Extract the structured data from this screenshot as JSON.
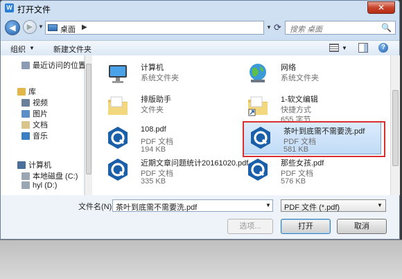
{
  "window": {
    "title": "打开文件",
    "close_glyph": "✕"
  },
  "nav": {
    "address_location": "桌面",
    "search_placeholder": "搜索 桌面"
  },
  "toolbar": {
    "organize_label": "组织",
    "new_folder_label": "新建文件夹"
  },
  "sidebar": {
    "items": [
      {
        "label": "最近访问的位置",
        "icon": "recent-places-icon",
        "color": "#8a9bb3"
      },
      {
        "label": "库",
        "icon": "library-icon",
        "color": "#e3b64a"
      },
      {
        "label": "视频",
        "icon": "video-icon",
        "color": "#6a7f9a"
      },
      {
        "label": "图片",
        "icon": "pictures-icon",
        "color": "#5b8fc7"
      },
      {
        "label": "文档",
        "icon": "documents-icon",
        "color": "#d9c589"
      },
      {
        "label": "音乐",
        "icon": "music-icon",
        "color": "#3a7fc4"
      },
      {
        "label": "计算机",
        "icon": "computer-icon",
        "color": "#4a6f9a"
      },
      {
        "label": "本地磁盘 (C:)",
        "icon": "disk-icon",
        "color": "#9aa6b2"
      },
      {
        "label": "hyl (D:)",
        "icon": "disk-icon",
        "color": "#9aa6b2"
      }
    ]
  },
  "files": [
    {
      "name": "计算机",
      "meta1": "系统文件夹",
      "meta2": "",
      "icon": "computer-icon",
      "selected": false
    },
    {
      "name": "网络",
      "meta1": "系统文件夹",
      "meta2": "",
      "icon": "network-icon",
      "selected": false
    },
    {
      "name": "排版助手",
      "meta1": "文件夹",
      "meta2": "",
      "icon": "folder-icon",
      "selected": false
    },
    {
      "name": "1-软文编辑",
      "meta1": "快捷方式",
      "meta2": "655 字节",
      "icon": "shortcut-folder-icon",
      "selected": false
    },
    {
      "name": "108.pdf",
      "meta1": "PDF 文档",
      "meta2": "194 KB",
      "icon": "pdf-icon",
      "selected": false
    },
    {
      "name": "茶叶到底需不需要洗.pdf",
      "meta1": "PDF 文档",
      "meta2": "581 KB",
      "icon": "pdf-icon",
      "selected": true
    },
    {
      "name": "近期文章问题统计20161020.pdf",
      "meta1": "PDF 文档",
      "meta2": "335 KB",
      "icon": "pdf-icon",
      "selected": false
    },
    {
      "name": "那些女孩.pdf",
      "meta1": "PDF 文档",
      "meta2": "576 KB",
      "icon": "pdf-icon",
      "selected": false
    }
  ],
  "bottom": {
    "filename_label": "文件名(N):",
    "filename_value": "茶叶到底需不需要洗.pdf",
    "filetype_value": "PDF 文件 (*.pdf)",
    "options_label": "选项...",
    "open_label": "打开",
    "cancel_label": "取消"
  },
  "colors": {
    "pdf_brand": "#1a5fa8",
    "selection": "#c1dcf7",
    "highlight_frame": "#d83030"
  }
}
